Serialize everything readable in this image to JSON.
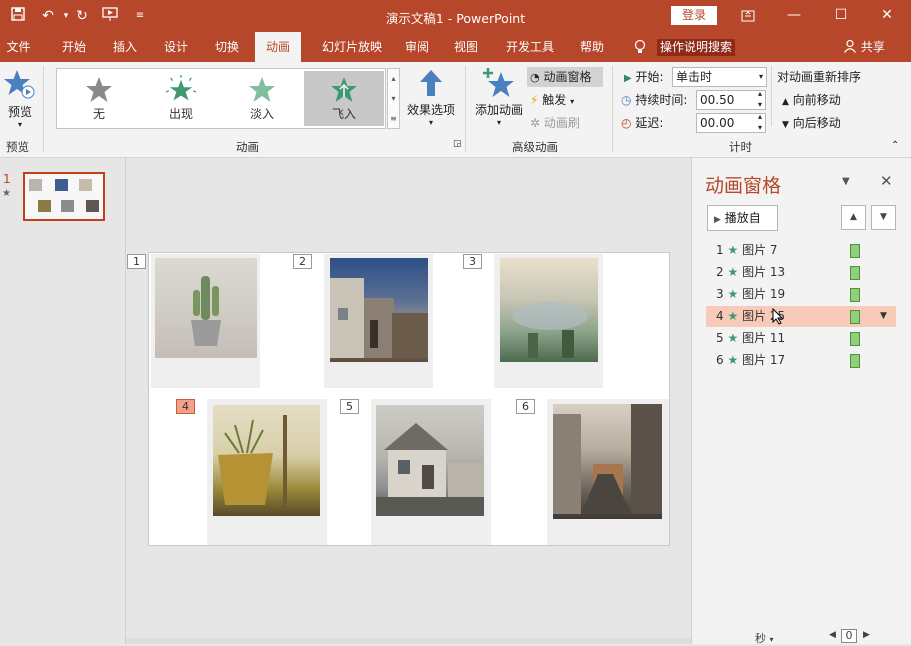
{
  "titlebar": {
    "title": "演示文稿1 - PowerPoint",
    "login_label": "登录",
    "icons": [
      "save-icon",
      "undo-icon",
      "redo-icon",
      "present-from-start-icon",
      "customize-icon"
    ]
  },
  "tabs": [
    "文件",
    "开始",
    "插入",
    "设计",
    "切换",
    "动画",
    "幻灯片放映",
    "审阅",
    "视图",
    "开发工具",
    "帮助"
  ],
  "active_tab": "动画",
  "search_tip": "操作说明搜索",
  "share_label": "共享",
  "ribbon": {
    "preview": {
      "label": "预览",
      "group": "预览"
    },
    "animation_gallery": {
      "items": [
        {
          "label": "无",
          "color": "#8a8a8a"
        },
        {
          "label": "出现",
          "color": "#3f9a72"
        },
        {
          "label": "淡入",
          "color": "#7fbf9e"
        },
        {
          "label": "飞入",
          "color": "#3f9a72"
        }
      ],
      "selected": "飞入",
      "group": "动画"
    },
    "effect_options": "效果选项",
    "advanced": {
      "add_animation": "添加动画",
      "animation_pane": "动画窗格",
      "trigger": "触发",
      "animation_painter": "动画刷",
      "group": "高级动画"
    },
    "timing": {
      "start_label": "开始:",
      "start_value": "单击时",
      "duration_label": "持续时间:",
      "duration_value": "00.50",
      "delay_label": "延迟:",
      "delay_value": "00.00",
      "reorder_title": "对动画重新排序",
      "move_earlier": "向前移动",
      "move_later": "向后移动",
      "group": "计时"
    }
  },
  "slide_panel": {
    "slide_number": "1",
    "star": "★"
  },
  "slide": {
    "photos": [
      {
        "num": "1",
        "colors": [
          "#d8d4cf",
          "#8a9a7a",
          "#6b6b6b"
        ]
      },
      {
        "num": "2",
        "colors": [
          "#2d4f86",
          "#b8b8c0",
          "#6a4f3a"
        ]
      },
      {
        "num": "3",
        "colors": [
          "#e9dccb",
          "#a3b8a8",
          "#5c7058"
        ]
      },
      {
        "num": "4",
        "colors": [
          "#e6ddc6",
          "#9c8b3c",
          "#584a2a"
        ]
      },
      {
        "num": "5",
        "colors": [
          "#c9c8c4",
          "#8e8f92",
          "#4a4a48"
        ]
      },
      {
        "num": "6",
        "colors": [
          "#cfc8bd",
          "#6c6459",
          "#3d3a35"
        ]
      }
    ],
    "highlight_num": "4"
  },
  "anim_pane": {
    "title": "动画窗格",
    "play_from": "播放自",
    "items": [
      {
        "num": "1",
        "name": "图片 7"
      },
      {
        "num": "2",
        "name": "图片 13"
      },
      {
        "num": "3",
        "name": "图片 19"
      },
      {
        "num": "4",
        "name": "图片 25"
      },
      {
        "num": "5",
        "name": "图片 11"
      },
      {
        "num": "6",
        "name": "图片 17"
      }
    ],
    "selected_index": 3
  },
  "status": {
    "seconds_label": "秒",
    "page_value": "0"
  }
}
